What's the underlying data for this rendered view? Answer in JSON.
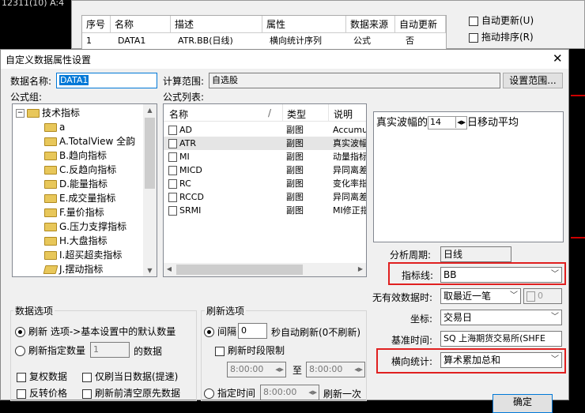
{
  "background": {
    "top_text": "12311(10) A:4",
    "table": {
      "headers": [
        "序号",
        "名称",
        "描述",
        "属性",
        "数据来源",
        "自动更新"
      ],
      "row": [
        "1",
        "DATA1",
        "ATR.BB(日线)",
        "横向统计序列",
        "公式",
        "否"
      ]
    },
    "checkboxes": [
      "自动更新(U)",
      "拖动排序(R)"
    ]
  },
  "dialog": {
    "title": "自定义数据属性设置",
    "close_symbol": "✕",
    "data_name_label": "数据名称:",
    "data_name_value": "DATA1",
    "calc_range_label": "计算范围:",
    "calc_range_value": "自选股",
    "set_range_button": "设置范围...",
    "formula_group_label": "公式组:",
    "formula_list_label": "公式列表:",
    "tree": {
      "root": "技术指标",
      "root_toggle": "−",
      "items": [
        "a",
        "A.TotalView 全韵",
        "B.趋向指标",
        "C.反趋向指标",
        "D.能量指标",
        "E.成交量指标",
        "F.量价指标",
        "G.压力支撑指标",
        "H.大盘指标",
        "I.超买超卖指标",
        "J.摆动指标"
      ]
    },
    "formula_table": {
      "headers": [
        "名称",
        "/",
        "类型",
        "说明"
      ],
      "rows": [
        [
          "AD",
          "副图",
          "Accumul"
        ],
        [
          "ATR",
          "副图",
          "真实波幅"
        ],
        [
          "MI",
          "副图",
          "动量指标"
        ],
        [
          "MICD",
          "副图",
          "异同离差"
        ],
        [
          "RC",
          "副图",
          "变化率指"
        ],
        [
          "RCCD",
          "副图",
          "异同离差"
        ],
        [
          "SRMI",
          "副图",
          "MI修正指"
        ]
      ]
    },
    "param_text_before": "真实波幅的",
    "param_value": "14",
    "param_text_after": "日移动平均",
    "analysis_period_label": "分析周期:",
    "analysis_period_value": "日线",
    "indicator_line_label": "指标线:",
    "indicator_line_value": "BB",
    "invalid_data_label": "无有效数据时:",
    "invalid_data_value": "取最近一笔",
    "invalid_data_number": "0",
    "axis_label": "坐标:",
    "axis_value": "交易日",
    "base_time_label": "基准时间:",
    "base_time_value": "SQ 上海期货交易所(SHFE",
    "horizontal_stat_label": "横向统计:",
    "horizontal_stat_value": "算术累加总和",
    "data_options": {
      "title": "数据选项",
      "radio1": "刷新 选项->基本设置中的默认数量",
      "radio2": "刷新指定数量",
      "radio2_value": "1",
      "radio2_suffix": "的数据",
      "cb1": "复权数据",
      "cb2": "仅刷当日数据(提速)",
      "cb3": "反转价格",
      "cb4": "刷新前清空原先数据"
    },
    "refresh_options": {
      "title": "刷新选项",
      "interval_label": "间隔",
      "interval_value": "0",
      "interval_suffix": "秒自动刷新(0不刷新)",
      "time_limit_label": "刷新时段限制",
      "from_time": "8:00:00",
      "to_label": "至",
      "to_time": "8:00:00",
      "fixed_time_label": "指定时间",
      "fixed_time_value": "8:00:00",
      "refresh_once_label": "刷新一次"
    },
    "ok_button": "确定"
  }
}
